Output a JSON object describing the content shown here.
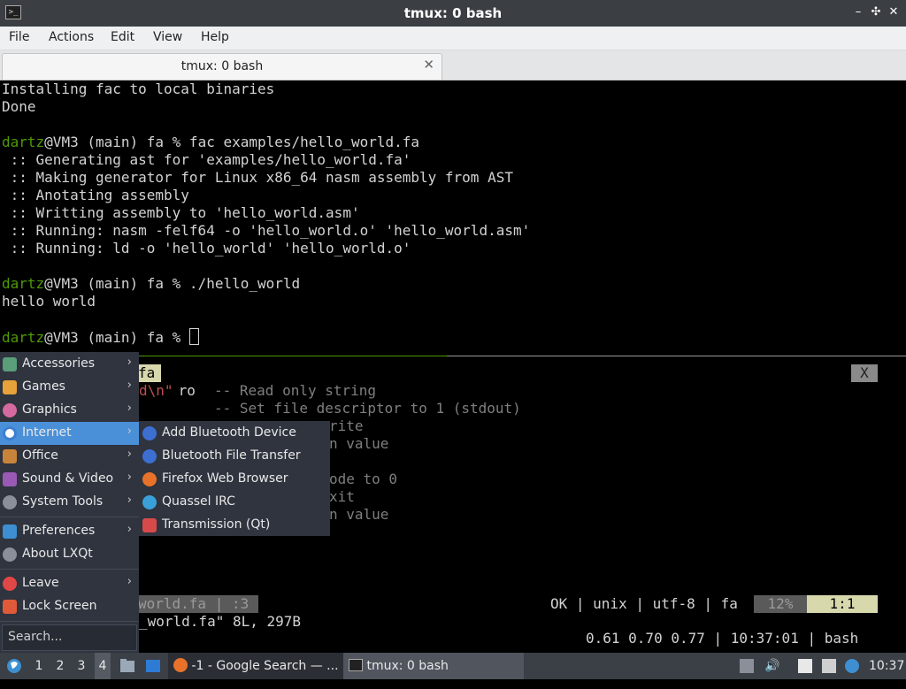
{
  "window": {
    "title": "tmux: 0 bash",
    "controls": {
      "minimize": "–",
      "maximize": "✣",
      "close": "✕"
    }
  },
  "menubar": {
    "file": "File",
    "actions": "Actions",
    "edit": "Edit",
    "view": "View",
    "help": "Help"
  },
  "tab": {
    "label": "tmux: 0 bash",
    "close": "✕"
  },
  "terminal": {
    "lines": [
      "Installing fac to local binaries",
      "Done",
      "",
      "",
      " :: Generating ast for 'examples/hello_world.fa'",
      " :: Making generator for Linux x86_64 nasm assembly from AST",
      " :: Anotating assembly",
      " :: Writting assembly to 'hello_world.asm'",
      " :: Running: nasm -felf64 -o 'hello_world.o' 'hello_world.asm'",
      " :: Running: ld -o 'hello_world' 'hello_world.o'",
      "",
      "",
      "hello world",
      "",
      ""
    ],
    "prompt_user": "dartz",
    "prompt_rest_1": "@VM3 (main) fa % fac examples/hello_world.fa",
    "prompt_rest_2": "@VM3 (main) fa % ./hello_world",
    "prompt_rest_3": "@VM3 (main) fa % "
  },
  "vim": {
    "tab_label": "fa",
    "close_label": "X",
    "line1_str": "d\\n\"",
    "line1_ro": " ro",
    "comment1": "-- Read only string",
    "comment2": "-- Set file descriptor to 1 (stdout)",
    "frag1": "rite",
    "frag2": "n value",
    "frag3": "ode to 0",
    "frag4": "xit",
    "frag5": "n value",
    "statusline_left": "world.fa | :3",
    "statusline_right": "OK | unix | utf-8 | fa",
    "statusline_pct": "12%",
    "statusline_pos": "1:1",
    "message": "_world.fa\" 8L, 297B"
  },
  "tmux_status": "0.61 0.70 0.77 | 10:37:01 | bash",
  "start_menu": {
    "items": [
      {
        "label": "Accessories",
        "icon_color": "#5a9e7a"
      },
      {
        "label": "Games",
        "icon_color": "#e8a23a"
      },
      {
        "label": "Graphics",
        "icon_color": "#d46a9f"
      },
      {
        "label": "Internet",
        "icon_color": "#3d7fd1"
      },
      {
        "label": "Office",
        "icon_color": "#c8843a"
      },
      {
        "label": "Sound & Video",
        "icon_color": "#9b59b6"
      },
      {
        "label": "System Tools",
        "icon_color": "#8a8f99"
      },
      {
        "label": "Preferences",
        "icon_color": "#3d8fd1"
      },
      {
        "label": "About LXQt",
        "icon_color": "#8a8f99"
      },
      {
        "label": "Leave",
        "icon_color": "#e04848"
      },
      {
        "label": "Lock Screen",
        "icon_color": "#e05a3a"
      }
    ],
    "search_placeholder": "Search..."
  },
  "internet_submenu": [
    {
      "label": "Add Bluetooth Device",
      "icon_color": "#3d6fd1"
    },
    {
      "label": "Bluetooth File Transfer",
      "icon_color": "#3d6fd1"
    },
    {
      "label": "Firefox Web Browser",
      "icon_color": "#e8722a"
    },
    {
      "label": "Quassel IRC",
      "icon_color": "#3aa0d8"
    },
    {
      "label": "Transmission (Qt)",
      "icon_color": "#d84a4a"
    }
  ],
  "taskbar": {
    "desktops": [
      "1",
      "2",
      "3",
      "4"
    ],
    "tasks": [
      "-1 - Google Search — ...",
      "tmux: 0 bash"
    ],
    "clock": "10:37"
  },
  "colors": {
    "prompt_green": "#4e9a06",
    "menu_highlight": "#4a90d9",
    "menu_bg": "#2f343f"
  }
}
